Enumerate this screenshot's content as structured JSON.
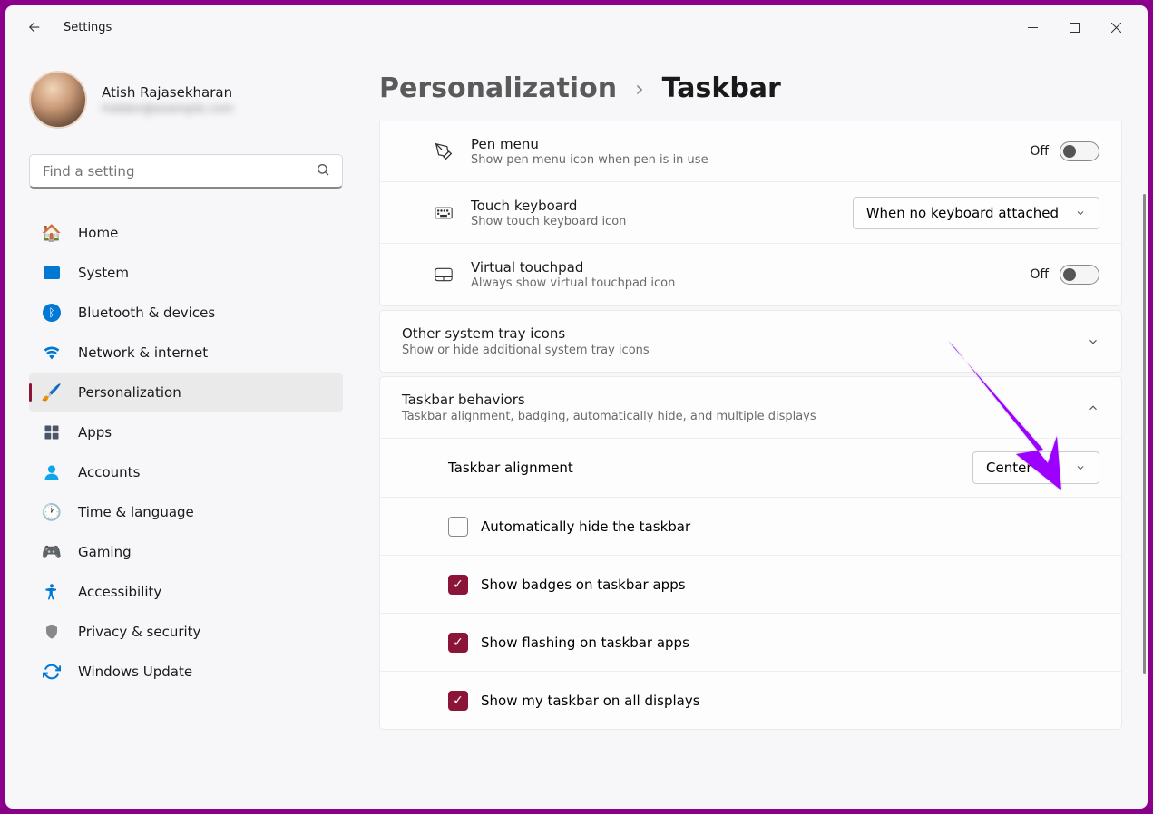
{
  "window": {
    "title": "Settings"
  },
  "profile": {
    "name": "Atish Rajasekharan",
    "email": "hidden@example.com"
  },
  "search": {
    "placeholder": "Find a setting"
  },
  "nav": [
    {
      "icon": "home",
      "label": "Home"
    },
    {
      "icon": "system",
      "label": "System"
    },
    {
      "icon": "bluetooth",
      "label": "Bluetooth & devices"
    },
    {
      "icon": "wifi",
      "label": "Network & internet"
    },
    {
      "icon": "brush",
      "label": "Personalization",
      "active": true
    },
    {
      "icon": "apps",
      "label": "Apps"
    },
    {
      "icon": "person",
      "label": "Accounts"
    },
    {
      "icon": "clock",
      "label": "Time & language"
    },
    {
      "icon": "game",
      "label": "Gaming"
    },
    {
      "icon": "accessibility",
      "label": "Accessibility"
    },
    {
      "icon": "shield",
      "label": "Privacy & security"
    },
    {
      "icon": "update",
      "label": "Windows Update"
    }
  ],
  "breadcrumb": {
    "parent": "Personalization",
    "current": "Taskbar"
  },
  "settings": {
    "pen": {
      "title": "Pen menu",
      "sub": "Show pen menu icon when pen is in use",
      "state": "Off"
    },
    "touch": {
      "title": "Touch keyboard",
      "sub": "Show touch keyboard icon",
      "value": "When no keyboard attached"
    },
    "touchpad": {
      "title": "Virtual touchpad",
      "sub": "Always show virtual touchpad icon",
      "state": "Off"
    }
  },
  "other_tray": {
    "title": "Other system tray icons",
    "sub": "Show or hide additional system tray icons"
  },
  "behaviors": {
    "title": "Taskbar behaviors",
    "sub": "Taskbar alignment, badging, automatically hide, and multiple displays",
    "alignment": {
      "label": "Taskbar alignment",
      "value": "Center"
    },
    "autohide": {
      "label": "Automatically hide the taskbar",
      "checked": false
    },
    "badges": {
      "label": "Show badges on taskbar apps",
      "checked": true
    },
    "flashing": {
      "label": "Show flashing on taskbar apps",
      "checked": true
    },
    "alldisplays": {
      "label": "Show my taskbar on all displays",
      "checked": true
    }
  }
}
